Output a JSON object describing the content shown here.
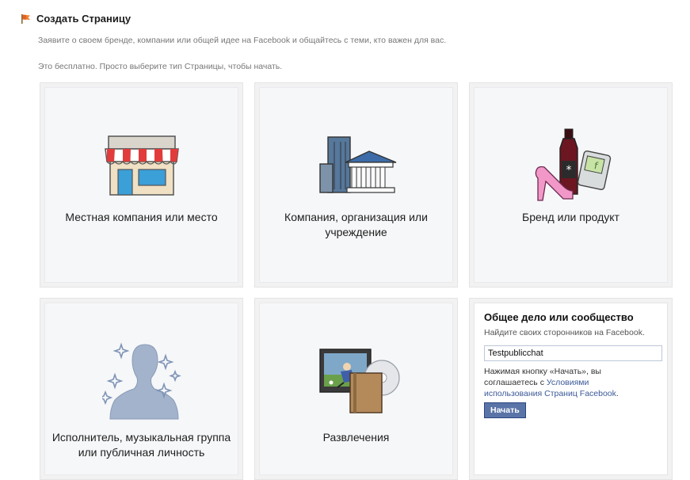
{
  "header": {
    "title": "Создать Страницу",
    "description": "Заявите о своем бренде, компании или общей идее на Facebook и общайтесь с теми, кто важен для вас.",
    "free_note": "Это бесплатно. Просто выберите тип Страницы, чтобы начать."
  },
  "tiles": [
    {
      "label": "Местная компания или место",
      "icon": "storefront-icon"
    },
    {
      "label": "Компания, организация или учреждение",
      "icon": "office-buildings-icon"
    },
    {
      "label": "Бренд или продукт",
      "icon": "brand-products-icon"
    },
    {
      "label": "Исполнитель, музыкальная группа или публичная личность",
      "icon": "public-figure-icon"
    },
    {
      "label": "Развлечения",
      "icon": "entertainment-icon"
    }
  ],
  "cause": {
    "title": "Общее дело или сообщество",
    "subtitle": "Найдите своих сторонников на Facebook.",
    "input_value": "Testpublicchat",
    "terms_text": "Нажимая кнопку «Начать», вы соглашаетесь с ",
    "terms_link": "Условиями использования Страниц Facebook",
    "terms_end": ".",
    "button_label": "Начать"
  },
  "colors": {
    "link": "#3b5998",
    "button_bg": "#5b74a8",
    "tile_bg": "#f6f7f9"
  }
}
